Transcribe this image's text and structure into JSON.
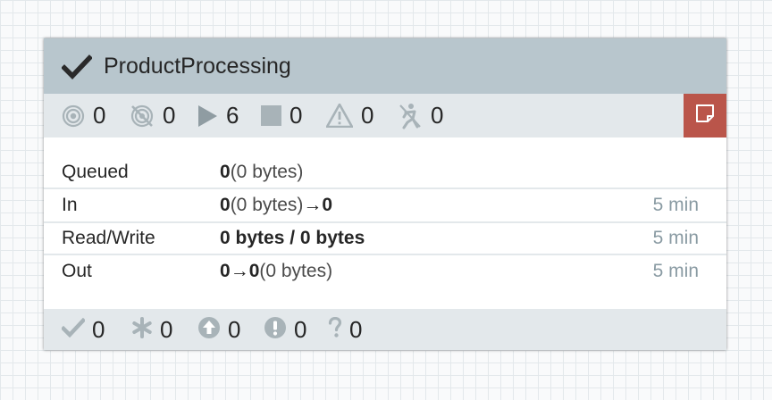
{
  "process_group": {
    "name": "ProductProcessing",
    "run_status": {
      "transmitting": "0",
      "not_transmitting": "0",
      "running": "6",
      "stopped": "0",
      "invalid": "0",
      "disabled": "0"
    },
    "comments_icon": "sticky-note-icon",
    "stats": {
      "queued": {
        "label": "Queued",
        "count": "0",
        "size": "(0 bytes)"
      },
      "in": {
        "label": "In",
        "count": "0",
        "size": "(0 bytes)",
        "arrow": "→",
        "ports": "0",
        "timeframe": "5 min"
      },
      "read_write": {
        "label": "Read/Write",
        "value": "0 bytes / 0 bytes",
        "timeframe": "5 min"
      },
      "out": {
        "label": "Out",
        "ports": "0",
        "arrow": "→",
        "count": "0",
        "size": "(0 bytes)",
        "timeframe": "5 min"
      }
    },
    "version_control": {
      "up_to_date": "0",
      "locally_modified": "0",
      "stale": "0",
      "locally_modified_and_stale": "0",
      "sync_failure": "0"
    }
  },
  "colors": {
    "header_bg": "#b8c6cd",
    "stats_bg": "#e3e8eb",
    "comments_bg": "#ba554a",
    "icon_gray": "#a8b3b8"
  }
}
